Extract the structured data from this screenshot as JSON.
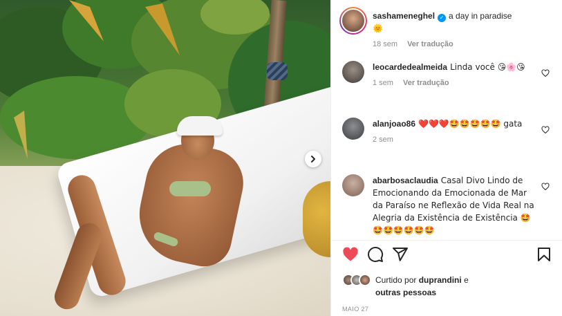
{
  "post": {
    "photo_alt": "",
    "owner": {
      "username": "sashameneghel",
      "caption": "a day in paradise",
      "caption_emoji": "🌞",
      "time": "18 sem",
      "translate": "Ver tradução"
    },
    "comments": [
      {
        "username": "leocardedealmeida",
        "text": "Linda você 😘🌸😘",
        "time": "1 sem",
        "translate": "Ver tradução"
      },
      {
        "username": "alanjoao86",
        "text": "❤️❤️❤️🤩🤩🤩🤩🤩 gata",
        "time": "2 sem"
      },
      {
        "username": "abarbosaclaudia",
        "text": "Casal Divo Lindo de Emocionando da Emocionada de Mar da Paraíso ne Reflexão de Vida Real na Alegria da Existência de Existência 🤩🤩🤩🤩🤩🤩🤩"
      }
    ],
    "likes": {
      "prefix": "Curtido por",
      "user": "duprandini",
      "conjunction": "e",
      "others": "outras pessoas"
    },
    "date": "MAIO 27"
  },
  "colors": {
    "like_red": "#ed4956",
    "link_grey": "#8e8e8e",
    "verified_blue": "#0095f6"
  },
  "icons": [
    "chevron-right-icon",
    "heart-icon",
    "comment-icon",
    "share-icon",
    "bookmark-icon",
    "verified-icon"
  ]
}
